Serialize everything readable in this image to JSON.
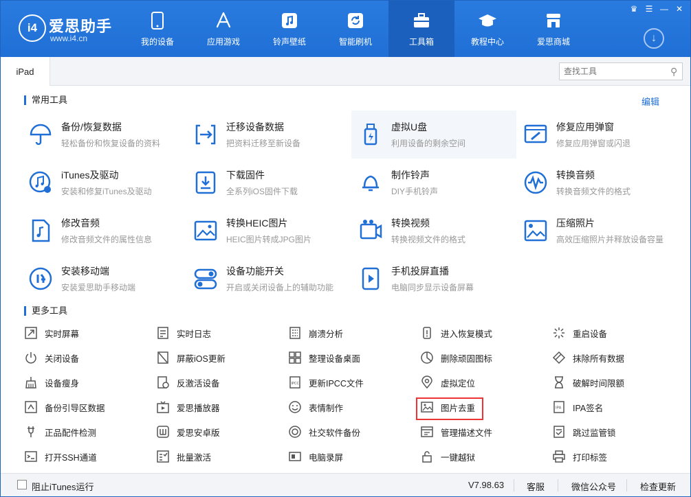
{
  "app": {
    "logo_text": "爱思助手",
    "logo_url_text": "www.i4.cn",
    "logo_badge": "i4"
  },
  "nav": [
    {
      "label": "我的设备",
      "icon": "phone-icon"
    },
    {
      "label": "应用游戏",
      "icon": "app-store-icon"
    },
    {
      "label": "铃声壁纸",
      "icon": "music-icon"
    },
    {
      "label": "智能刷机",
      "icon": "refresh-icon"
    },
    {
      "label": "工具箱",
      "icon": "toolbox-icon"
    },
    {
      "label": "教程中心",
      "icon": "graduation-cap-icon"
    },
    {
      "label": "爱思商城",
      "icon": "store-icon"
    }
  ],
  "active_nav": "工具箱",
  "device_tab": "iPad",
  "search": {
    "placeholder": "查找工具"
  },
  "common": {
    "title": "常用工具",
    "edit_label": "编辑",
    "tools": [
      {
        "title": "备份/恢复数据",
        "desc": "轻松备份和恢复设备的资料",
        "icon": "umbrella-icon"
      },
      {
        "title": "迁移设备数据",
        "desc": "把资料迁移至新设备",
        "icon": "transfer-icon"
      },
      {
        "title": "虚拟U盘",
        "desc": "利用设备的剩余空间",
        "icon": "usb-drive-icon"
      },
      {
        "title": "修复应用弹窗",
        "desc": "修复应用弹窗或闪退",
        "icon": "repair-window-icon"
      },
      {
        "title": "iTunes及驱动",
        "desc": "安装和修复iTunes及驱动",
        "icon": "itunes-icon"
      },
      {
        "title": "下载固件",
        "desc": "全系列iOS固件下载",
        "icon": "download-firmware-icon"
      },
      {
        "title": "制作铃声",
        "desc": "DIY手机铃声",
        "icon": "bell-icon"
      },
      {
        "title": "转换音频",
        "desc": "转换音频文件的格式",
        "icon": "audio-wave-icon"
      },
      {
        "title": "修改音频",
        "desc": "修改音频文件的属性信息",
        "icon": "audio-file-icon"
      },
      {
        "title": "转换HEIC图片",
        "desc": "HEIC图片转成JPG图片",
        "icon": "heic-image-icon"
      },
      {
        "title": "转换视频",
        "desc": "转换视频文件的格式",
        "icon": "video-convert-icon"
      },
      {
        "title": "压缩照片",
        "desc": "高效压缩照片并释放设备容量",
        "icon": "compress-photo-icon"
      },
      {
        "title": "安装移动端",
        "desc": "安装爱思助手移动端",
        "icon": "i4-mobile-icon"
      },
      {
        "title": "设备功能开关",
        "desc": "开启或关闭设备上的辅助功能",
        "icon": "toggle-icon"
      },
      {
        "title": "手机投屏直播",
        "desc": "电脑同步显示设备屏幕",
        "icon": "screen-cast-icon"
      }
    ]
  },
  "more": {
    "title": "更多工具",
    "tools": [
      {
        "label": "实时屏幕",
        "icon": "realtime-screen-icon"
      },
      {
        "label": "实时日志",
        "icon": "log-icon"
      },
      {
        "label": "崩溃分析",
        "icon": "crash-analysis-icon"
      },
      {
        "label": "进入恢复模式",
        "icon": "recovery-mode-icon"
      },
      {
        "label": "重启设备",
        "icon": "restart-icon"
      },
      {
        "label": "关闭设备",
        "icon": "power-icon"
      },
      {
        "label": "屏蔽iOS更新",
        "icon": "block-update-icon"
      },
      {
        "label": "整理设备桌面",
        "icon": "grid-icon"
      },
      {
        "label": "删除顽固图标",
        "icon": "delete-icon-icon"
      },
      {
        "label": "抹除所有数据",
        "icon": "eraser-icon"
      },
      {
        "label": "设备瘦身",
        "icon": "broom-icon"
      },
      {
        "label": "反激活设备",
        "icon": "deactivate-icon"
      },
      {
        "label": "更新IPCC文件",
        "icon": "ipcc-icon"
      },
      {
        "label": "虚拟定位",
        "icon": "location-pin-icon"
      },
      {
        "label": "破解时间限额",
        "icon": "hourglass-icon"
      },
      {
        "label": "备份引导区数据",
        "icon": "backup-boot-icon"
      },
      {
        "label": "爱思播放器",
        "icon": "tv-player-icon"
      },
      {
        "label": "表情制作",
        "icon": "smiley-icon"
      },
      {
        "label": "图片去重",
        "icon": "image-dedupe-icon"
      },
      {
        "label": "IPA签名",
        "icon": "ipa-sign-icon"
      },
      {
        "label": "正品配件检测",
        "icon": "accessory-check-icon"
      },
      {
        "label": "爱思安卓版",
        "icon": "android-app-icon"
      },
      {
        "label": "社交软件备份",
        "icon": "social-backup-icon"
      },
      {
        "label": "管理描述文件",
        "icon": "profile-icon"
      },
      {
        "label": "跳过监管锁",
        "icon": "supervision-icon"
      },
      {
        "label": "打开SSH通道",
        "icon": "ssh-terminal-icon"
      },
      {
        "label": "批量激活",
        "icon": "batch-activate-icon"
      },
      {
        "label": "电脑录屏",
        "icon": "screen-record-icon"
      },
      {
        "label": "一键越狱",
        "icon": "jailbreak-icon"
      },
      {
        "label": "打印标签",
        "icon": "printer-icon"
      }
    ],
    "highlighted": "图片去重"
  },
  "bottom": {
    "itunes_block_label": "阻止iTunes运行",
    "version": "V7.98.63",
    "service": "客服",
    "wechat": "微信公众号",
    "update": "检查更新"
  },
  "colors": {
    "primary": "#1f6fd6",
    "highlight_box": "#e33333"
  }
}
